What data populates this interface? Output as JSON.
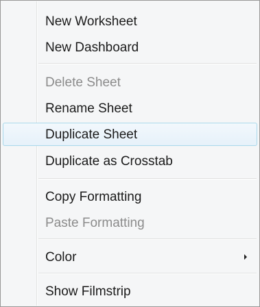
{
  "menu": {
    "items": [
      {
        "label": "New Worksheet",
        "enabled": true
      },
      {
        "label": "New Dashboard",
        "enabled": true
      },
      {
        "label": "Delete Sheet",
        "enabled": false
      },
      {
        "label": "Rename Sheet",
        "enabled": true
      },
      {
        "label": "Duplicate Sheet",
        "enabled": true,
        "highlighted": true
      },
      {
        "label": "Duplicate as Crosstab",
        "enabled": true
      },
      {
        "label": "Copy Formatting",
        "enabled": true
      },
      {
        "label": "Paste Formatting",
        "enabled": false
      },
      {
        "label": "Color",
        "enabled": true,
        "has_submenu": true,
        "submenu_icon": "chevron-right-icon"
      },
      {
        "label": "Show Filmstrip",
        "enabled": true
      }
    ]
  },
  "colors": {
    "menu_background": "#f5f6f7",
    "disabled_text": "#8b8b8b",
    "highlight_border": "#a8d8eb",
    "highlight_fill": "#e6f1fa"
  }
}
